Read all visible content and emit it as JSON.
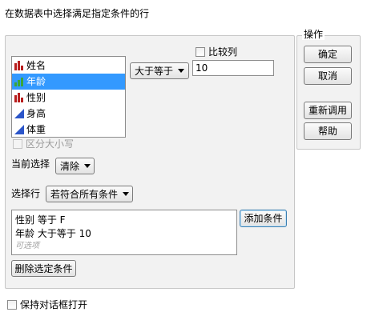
{
  "header": {
    "title": "在数据表中选择满足指定条件的行"
  },
  "columns": [
    {
      "name": "姓名",
      "icon": "nominal-bar-icon",
      "selected": false
    },
    {
      "name": "年龄",
      "icon": "ordinal-bar-icon",
      "selected": true
    },
    {
      "name": "性别",
      "icon": "nominal-bar-icon",
      "selected": false
    },
    {
      "name": "身高",
      "icon": "continuous-triangle-icon",
      "selected": false
    },
    {
      "name": "体重",
      "icon": "continuous-triangle-icon",
      "selected": false
    }
  ],
  "operator": {
    "value": "大于等于"
  },
  "compare_column": {
    "label": "比较列",
    "checked": false
  },
  "value_field": {
    "value": "10"
  },
  "case_sensitive": {
    "label": "区分大小写",
    "checked": false,
    "disabled": true
  },
  "current_selection": {
    "label": "当前选择",
    "value": "清除"
  },
  "select_rows": {
    "label": "选择行",
    "value": "若符合所有条件"
  },
  "conditions": {
    "items": [
      "性别 等于 F",
      "年龄 大于等于 10"
    ],
    "hint": "可选项"
  },
  "buttons": {
    "add_condition": "添加条件",
    "delete_condition": "删除选定条件"
  },
  "actions": {
    "title": "操作",
    "ok": "确定",
    "cancel": "取消",
    "recall": "重新调用",
    "help": "帮助"
  },
  "keep_open": {
    "label": "保持对话框打开",
    "checked": false
  },
  "colors": {
    "selection": "#3399ff",
    "nominal_icon": "#b81e1e",
    "ordinal_icon": "#3aa63a",
    "continuous_icon": "#2b55c9"
  }
}
